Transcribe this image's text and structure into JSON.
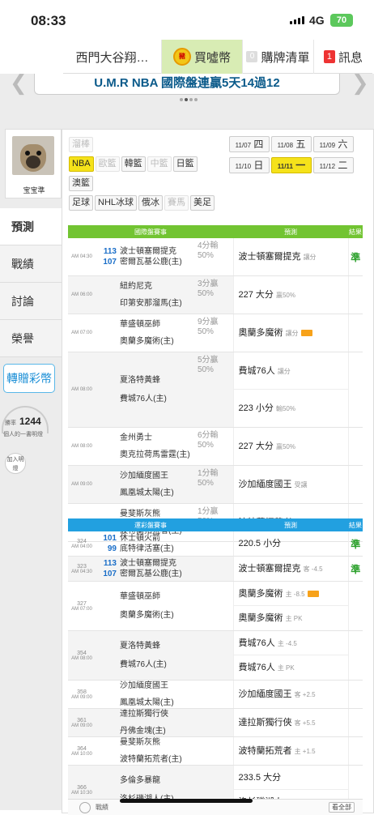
{
  "status": {
    "time": "08:33",
    "network": "4G",
    "battery": "70"
  },
  "topnav": {
    "team": "西門大谷翔…",
    "coin_logo": "豬",
    "buy": "買噓幣",
    "cart_count": "0",
    "cart": "購牌清單",
    "msg_count": "1",
    "msg": "訊息"
  },
  "banner": {
    "text": "U.M.R NBA 國際盤連贏5天14過12"
  },
  "profile": {
    "name": "宝宝準"
  },
  "left_menu": [
    "預測",
    "戰績",
    "討論",
    "榮譽"
  ],
  "gift_button": "轉贈彩幣",
  "points": {
    "label": "勝率",
    "value": "1244",
    "sub": "個人的一書明燈"
  },
  "add_mark": "加入明燈",
  "filters": {
    "row1": [
      {
        "label": "溜棒",
        "state": "dim"
      }
    ],
    "row2": [
      {
        "label": "NBA",
        "state": "sel"
      },
      {
        "label": "歐籃",
        "state": "dim"
      },
      {
        "label": "韓籃",
        "state": "normal"
      },
      {
        "label": "中籃",
        "state": "dim"
      },
      {
        "label": "日籃",
        "state": "normal"
      }
    ],
    "row3": [
      {
        "label": "澳籃",
        "state": "normal"
      }
    ],
    "row4": [
      {
        "label": "足球",
        "state": "normal"
      },
      {
        "label": "NHL冰球",
        "state": "normal"
      },
      {
        "label": "俄冰",
        "state": "normal"
      },
      {
        "label": "賽馬",
        "state": "dim"
      },
      {
        "label": "美足",
        "state": "normal"
      }
    ]
  },
  "dates": [
    {
      "md": "11/07",
      "wd": "四",
      "sel": false
    },
    {
      "md": "11/08",
      "wd": "五",
      "sel": false
    },
    {
      "md": "11/09",
      "wd": "六",
      "sel": false
    },
    {
      "md": "11/10",
      "wd": "日",
      "sel": false
    },
    {
      "md": "11/11",
      "wd": "一",
      "sel": true
    },
    {
      "md": "11/12",
      "wd": "二",
      "sel": false
    }
  ],
  "intl": {
    "headers": [
      "國際盤賽事",
      "預測",
      "結果"
    ],
    "rows": [
      {
        "time": "AM 04:30",
        "t1": "波士頓塞爾提克",
        "s1": "113",
        "t2": "密爾瓦基公鹿(主)",
        "s2": "107",
        "hc1": "4分輸",
        "hc2": "50%",
        "picks": [
          {
            "text": "波士頓塞爾提克",
            "tag": "讓分",
            "hot": false
          }
        ],
        "result": "準"
      },
      {
        "time": "AM 06:00",
        "t1": "紐約尼克",
        "s1": "",
        "t2": "印第安那溜馬(主)",
        "s2": "",
        "hc1": "3分贏",
        "hc2": "50%",
        "picks": [
          {
            "text": "227 大分",
            "tag": "贏50%",
            "hot": false
          }
        ],
        "result": ""
      },
      {
        "time": "AM 07:00",
        "t1": "華盛頓巫師",
        "s1": "",
        "t2": "奧蘭多魔術(主)",
        "s2": "",
        "hc1": "9分贏",
        "hc2": "50%",
        "picks": [
          {
            "text": "奧蘭多魔術",
            "tag": "讓分",
            "hot": true
          }
        ],
        "result": ""
      },
      {
        "time": "AM 08:00",
        "t1": "夏洛特黃蜂",
        "s1": "",
        "t2": "費城76人(主)",
        "s2": "",
        "hc1": "5分贏",
        "hc2": "50%",
        "picks": [
          {
            "text": "費城76人",
            "tag": "讓分",
            "hot": false
          },
          {
            "text": "223 小分",
            "tag": "輸50%",
            "hot": false
          }
        ],
        "result": ""
      },
      {
        "time": "AM 08:00",
        "t1": "金州勇士",
        "s1": "",
        "t2": "奧克拉荷馬雷霆(主)",
        "s2": "",
        "hc1": "6分輸",
        "hc2": "50%",
        "picks": [
          {
            "text": "227 大分",
            "tag": "贏50%",
            "hot": false
          }
        ],
        "result": ""
      },
      {
        "time": "AM 09:00",
        "t1": "沙加緬度國王",
        "s1": "",
        "t2": "鳳凰城太陽(主)",
        "s2": "",
        "hc1": "1分輸",
        "hc2": "50%",
        "picks": [
          {
            "text": "沙加緬度國王",
            "tag": "受讓",
            "hot": false
          }
        ],
        "result": ""
      },
      {
        "time": "AM 10:00",
        "t1": "曼斐斯灰熊",
        "s1": "",
        "t2": "波特蘭拓荒者(主)",
        "s2": "",
        "hc1": "1分贏",
        "hc2": "50%",
        "picks": [
          {
            "text": "波特蘭拓荒者",
            "tag": "受讓",
            "hot": false
          }
        ],
        "result": ""
      }
    ]
  },
  "lottery": {
    "headers": [
      "運彩盤賽事",
      "預測",
      "結果"
    ],
    "rows": [
      {
        "no": "324",
        "time": "AM 04:00",
        "t1": "休士頓火箭",
        "s1": "101",
        "t2": "底特律活塞(主)",
        "s2": "99",
        "picks": [
          {
            "text": "220.5 小分",
            "tag": "",
            "hot": false
          }
        ],
        "result": "準"
      },
      {
        "no": "323",
        "time": "AM 04:30",
        "t1": "波士頓塞爾提克",
        "s1": "113",
        "t2": "密爾瓦基公鹿(主)",
        "s2": "107",
        "picks": [
          {
            "text": "波士頓塞爾提克",
            "tag": "客 -4.5",
            "hot": false
          }
        ],
        "result": "準"
      },
      {
        "no": "327",
        "time": "AM 07:00",
        "t1": "華盛頓巫師",
        "s1": "",
        "t2": "奧蘭多魔術(主)",
        "s2": "",
        "picks": [
          {
            "text": "奧蘭多魔術",
            "tag": "主 -8.5",
            "hot": true
          },
          {
            "text": "奧蘭多魔術",
            "tag": "主 PK",
            "hot": false
          }
        ],
        "result": ""
      },
      {
        "no": "354",
        "time": "AM 08:00",
        "t1": "夏洛特黃蜂",
        "s1": "",
        "t2": "費城76人(主)",
        "s2": "",
        "picks": [
          {
            "text": "費城76人",
            "tag": "主 -4.5",
            "hot": false
          },
          {
            "text": "費城76人",
            "tag": "主 PK",
            "hot": false
          }
        ],
        "result": ""
      },
      {
        "no": "358",
        "time": "AM 09:00",
        "t1": "沙加緬度國王",
        "s1": "",
        "t2": "鳳凰城太陽(主)",
        "s2": "",
        "picks": [
          {
            "text": "沙加緬度國王",
            "tag": "客 +2.5",
            "hot": false
          }
        ],
        "result": ""
      },
      {
        "no": "361",
        "time": "AM 09:00",
        "t1": "達拉斯獨行俠",
        "s1": "",
        "t2": "丹佛金塊(主)",
        "s2": "",
        "picks": [
          {
            "text": "達拉斯獨行俠",
            "tag": "客 +5.5",
            "hot": false
          }
        ],
        "result": ""
      },
      {
        "no": "364",
        "time": "AM 10:00",
        "t1": "曼斐斯灰熊",
        "s1": "",
        "t2": "波特蘭拓荒者(主)",
        "s2": "",
        "picks": [
          {
            "text": "波特蘭拓荒者",
            "tag": "主 +1.5",
            "hot": false
          }
        ],
        "result": ""
      },
      {
        "no": "366",
        "time": "AM 10:30",
        "t1": "多倫多暴龍",
        "s1": "",
        "t2": "洛杉磯湖人(主)",
        "s2": "",
        "picks": [
          {
            "text": "233.5 大分",
            "tag": "",
            "hot": false
          },
          {
            "text": "洛杉磯湖人",
            "tag": "主 PK",
            "hot": false
          }
        ],
        "result": ""
      }
    ]
  },
  "footer": {
    "label": "戰績",
    "button": "看全部"
  }
}
